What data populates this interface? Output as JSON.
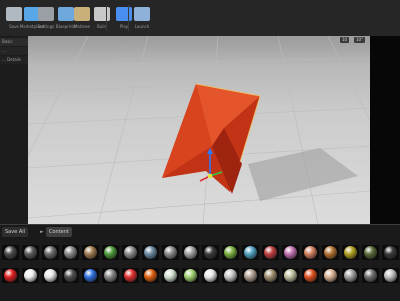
{
  "toolbar": {
    "items": [
      {
        "label": "Save",
        "icon": "save-icon",
        "color": "#b0b8c0"
      },
      {
        "label": "Marketplace",
        "icon": "marketplace-icon",
        "color": "#5aa7e8"
      },
      {
        "label": "Settings",
        "icon": "gear-icon",
        "color": "#9aa0a6"
      },
      {
        "label": "Blueprints",
        "icon": "blueprint-icon",
        "color": "#6fa8dc"
      },
      {
        "label": "Matinee",
        "icon": "matinee-icon",
        "color": "#c9b07a"
      },
      {
        "label": "Build",
        "icon": "build-icon",
        "color": "#c8c8c8"
      },
      {
        "label": "Play",
        "icon": "play-icon",
        "color": "#4a8ff0"
      },
      {
        "label": "Launch",
        "icon": "launch-icon",
        "color": "#8fb0d8"
      }
    ]
  },
  "left_panel": {
    "tabs": [
      "Basic",
      "...",
      "... Details"
    ]
  },
  "viewport": {
    "controls": [
      "10",
      "10°"
    ],
    "object_color": "#d9431c",
    "floor_color": "#dcdcdc"
  },
  "content_browser": {
    "tabs": [
      {
        "label": "Save All"
      },
      {
        "label": "Content"
      }
    ],
    "row1": [
      {
        "label": "",
        "color": "#4a4a4a"
      },
      {
        "label": "",
        "color": "#5a5a5a"
      },
      {
        "label": "",
        "color": "#6a6a6a"
      },
      {
        "label": "",
        "color": "#888888"
      },
      {
        "label": "",
        "color": "#a07a50"
      },
      {
        "label": "",
        "color": "#4e9a3a"
      },
      {
        "label": "",
        "color": "#8a8a8a"
      },
      {
        "label": "",
        "color": "#6a8aa0"
      },
      {
        "label": "",
        "color": "#8a8a8a"
      },
      {
        "label": "",
        "color": "#a0a0a0"
      },
      {
        "label": "",
        "color": "#3a3a3a"
      },
      {
        "label": "",
        "color": "#7ab040"
      },
      {
        "label": "",
        "color": "#50a0c0"
      },
      {
        "label": "",
        "color": "#c04040"
      },
      {
        "label": "",
        "color": "#c070b0"
      },
      {
        "label": "",
        "color": "#d08060"
      },
      {
        "label": "",
        "color": "#b07030"
      },
      {
        "label": "",
        "color": "#b0a020"
      },
      {
        "label": "",
        "color": "#5a6a3a"
      },
      {
        "label": "",
        "color": "#3a3a3a"
      }
    ],
    "row2": [
      {
        "label": "",
        "color": "#e02020"
      },
      {
        "label": "",
        "color": "#eeeeee"
      },
      {
        "label": "",
        "color": "#e8e8e8"
      },
      {
        "label": "",
        "color": "#505050"
      },
      {
        "label": "",
        "color": "#3070e0"
      },
      {
        "label": "",
        "color": "#888888"
      },
      {
        "label": "",
        "color": "#e03030"
      },
      {
        "label": "",
        "color": "#e06010"
      },
      {
        "label": "",
        "color": "#d0e0d0"
      },
      {
        "label": "",
        "color": "#a0d070"
      },
      {
        "label": "",
        "color": "#e8e8e8"
      },
      {
        "label": "",
        "color": "#c8c8c8"
      },
      {
        "label": "",
        "color": "#b0a090"
      },
      {
        "label": "",
        "color": "#a09070"
      },
      {
        "label": "",
        "color": "#c0c0a0"
      },
      {
        "label": "",
        "color": "#e05020"
      },
      {
        "label": "",
        "color": "#d8b090"
      },
      {
        "label": "",
        "color": "#a0a0a0"
      },
      {
        "label": "",
        "color": "#707070"
      },
      {
        "label": "",
        "color": "#c0c0c0"
      }
    ]
  }
}
